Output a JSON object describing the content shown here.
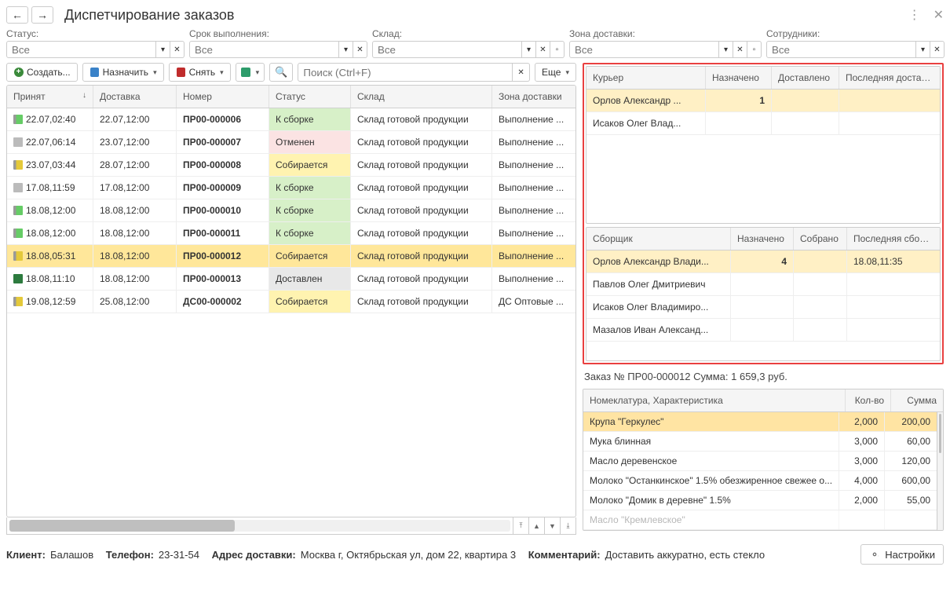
{
  "header": {
    "title": "Диспетчирование заказов"
  },
  "filters": {
    "status": {
      "label": "Статус:",
      "placeholder": "Все"
    },
    "due": {
      "label": "Срок выполнения:",
      "placeholder": "Все"
    },
    "whs": {
      "label": "Склад:",
      "placeholder": "Все"
    },
    "zone": {
      "label": "Зона доставки:",
      "placeholder": "Все"
    },
    "staff": {
      "label": "Сотрудники:",
      "placeholder": "Все"
    }
  },
  "toolbar": {
    "create": "Создать...",
    "assign": "Назначить",
    "remove": "Снять",
    "search_placeholder": "Поиск (Ctrl+F)",
    "more": "Еще"
  },
  "orders": {
    "headers": {
      "accepted": "Принят",
      "delivery": "Доставка",
      "number": "Номер",
      "status": "Статус",
      "warehouse": "Склад",
      "zone": "Зона доставки"
    },
    "rows": [
      {
        "icon": "green",
        "accepted": "22.07,02:40",
        "delivery": "22.07,12:00",
        "number": "ПР00-000006",
        "status": "К сборке",
        "st": "green",
        "warehouse": "Склад готовой продукции",
        "zone": "Выполнение ..."
      },
      {
        "icon": "grey",
        "accepted": "22.07,06:14",
        "delivery": "23.07,12:00",
        "number": "ПР00-000007",
        "status": "Отменен",
        "st": "red",
        "warehouse": "Склад готовой продукции",
        "zone": "Выполнение ..."
      },
      {
        "icon": "yellow",
        "accepted": "23.07,03:44",
        "delivery": "28.07,12:00",
        "number": "ПР00-000008",
        "status": "Собирается",
        "st": "yellow",
        "warehouse": "Склад готовой продукции",
        "zone": "Выполнение ..."
      },
      {
        "icon": "grey",
        "accepted": "17.08,11:59",
        "delivery": "17.08,12:00",
        "number": "ПР00-000009",
        "status": "К сборке",
        "st": "green",
        "warehouse": "Склад готовой продукции",
        "zone": "Выполнение ..."
      },
      {
        "icon": "green",
        "accepted": "18.08,12:00",
        "delivery": "18.08,12:00",
        "number": "ПР00-000010",
        "status": "К сборке",
        "st": "green",
        "warehouse": "Склад готовой продукции",
        "zone": "Выполнение ..."
      },
      {
        "icon": "green",
        "accepted": "18.08,12:00",
        "delivery": "18.08,12:00",
        "number": "ПР00-000011",
        "status": "К сборке",
        "st": "green",
        "warehouse": "Склад готовой продукции",
        "zone": "Выполнение ..."
      },
      {
        "icon": "yellow",
        "accepted": "18.08,05:31",
        "delivery": "18.08,12:00",
        "number": "ПР00-000012",
        "status": "Собирается",
        "st": "yellow",
        "warehouse": "Склад готовой продукции",
        "zone": "Выполнение ...",
        "selected": true
      },
      {
        "icon": "darkg",
        "accepted": "18.08,11:10",
        "delivery": "18.08,12:00",
        "number": "ПР00-000013",
        "status": "Доставлен",
        "st": "grey",
        "warehouse": "Склад готовой продукции",
        "zone": "Выполнение ..."
      },
      {
        "icon": "yellow",
        "accepted": "19.08,12:59",
        "delivery": "25.08,12:00",
        "number": "ДС00-000002",
        "status": "Собирается",
        "st": "yellow",
        "warehouse": "Склад готовой продукции",
        "zone": "ДС Оптовые ..."
      }
    ]
  },
  "couriers": {
    "headers": {
      "name": "Курьер",
      "assigned": "Назначено",
      "delivered": "Доставлено",
      "lastdel": "Последняя доставка"
    },
    "rows": [
      {
        "name": "Орлов Александр ...",
        "assigned": "1",
        "delivered": "",
        "lastdel": "",
        "hl": true
      },
      {
        "name": "Исаков Олег Влад...",
        "assigned": "",
        "delivered": "",
        "lastdel": ""
      }
    ]
  },
  "pickers": {
    "headers": {
      "name": "Сборщик",
      "assigned": "Назначено",
      "picked": "Собрано",
      "lastp": "Последняя сборка"
    },
    "rows": [
      {
        "name": "Орлов Александр Влади...",
        "assigned": "4",
        "picked": "",
        "lastp": "18.08,11:35",
        "hl": true
      },
      {
        "name": "Павлов Олег Дмитриевич",
        "assigned": "",
        "picked": "",
        "lastp": ""
      },
      {
        "name": "Исаков Олег Владимиро...",
        "assigned": "",
        "picked": "",
        "lastp": ""
      },
      {
        "name": "Мазалов Иван Александ...",
        "assigned": "",
        "picked": "",
        "lastp": ""
      }
    ]
  },
  "summary": "Заказ № ПР00-000012   Сумма: 1 659,3 руб.",
  "items": {
    "headers": {
      "name": "Номеклатура, Характеристика",
      "qty": "Кол-во",
      "sum": "Сумма"
    },
    "rows": [
      {
        "name": "Крупа \"Геркулес\"",
        "qty": "2,000",
        "sum": "200,00"
      },
      {
        "name": "Мука блинная",
        "qty": "3,000",
        "sum": "60,00"
      },
      {
        "name": "Масло деревенское",
        "qty": "3,000",
        "sum": "120,00"
      },
      {
        "name": "Молоко \"Останкинское\" 1.5% обезжиренное свежее о...",
        "qty": "4,000",
        "sum": "600,00"
      },
      {
        "name": "Молоко \"Домик в деревне\" 1.5%",
        "qty": "2,000",
        "sum": "55,00"
      },
      {
        "name": "Масло \"Кремлевское\"",
        "qty": "",
        "sum": "",
        "cut": true
      }
    ]
  },
  "footer": {
    "client_l": "Клиент:",
    "client": "Балашов",
    "phone_l": "Телефон:",
    "phone": "23-31-54",
    "addr_l": "Адрес доставки:",
    "addr": "Москва г, Октябрьская ул, дом 22, квартира 3",
    "comm_l": "Комментарий:",
    "comm": "Доставить аккуратно, есть стекло",
    "settings": "Настройки"
  }
}
